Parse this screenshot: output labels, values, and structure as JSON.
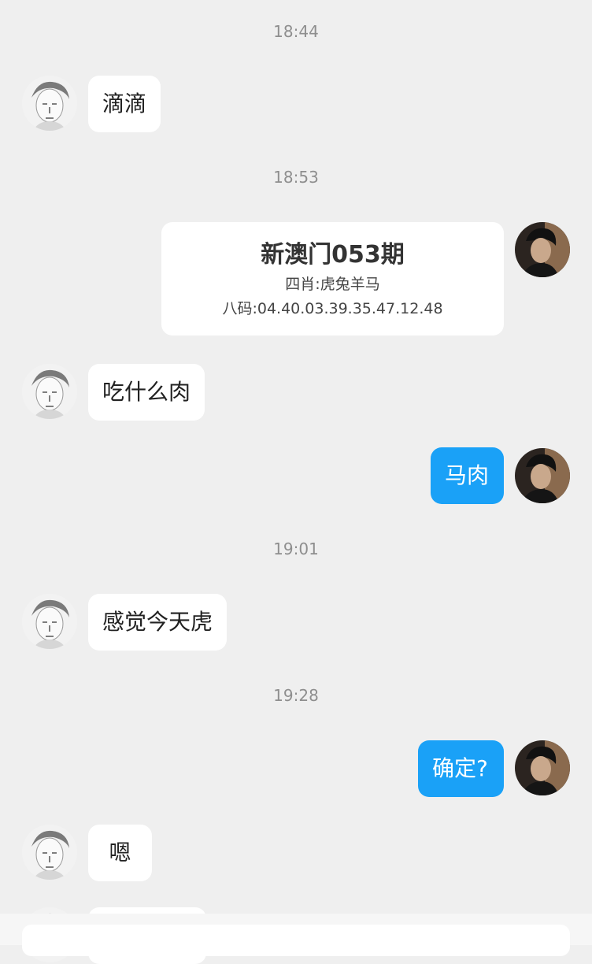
{
  "chat": {
    "timestamps": [
      "18:44",
      "18:53",
      "19:01",
      "19:28"
    ],
    "messages": [
      {
        "text": "滴滴"
      },
      {
        "text": "吃什么肉"
      },
      {
        "text": "马肉"
      },
      {
        "text": "感觉今天虎"
      },
      {
        "text": "确定?"
      },
      {
        "text": "嗯"
      }
    ],
    "card": {
      "title": "新澳门053期",
      "line1": "四肖:虎兔羊马",
      "line2": "八码:04.40.03.39.35.47.12.48"
    }
  }
}
